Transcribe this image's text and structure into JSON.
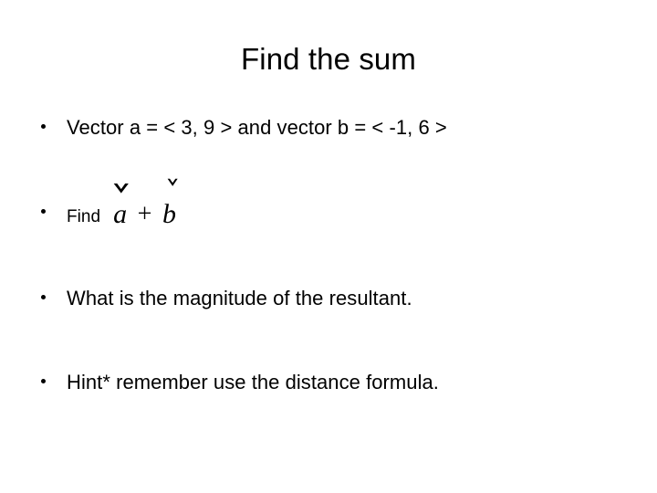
{
  "slide": {
    "background_color": "#ffffff",
    "text_color": "#000000",
    "title": "Find the sum",
    "bullets": [
      {
        "id": "vectors-given",
        "text": "Vector  a = < 3, 9 >  and vector  b = < -1, 6 >"
      },
      {
        "id": "find-sum",
        "text": "Find",
        "math": {
          "left_operand": "a",
          "operator": "+",
          "right_operand": "b",
          "left_accent": "caron",
          "right_accent": "caron",
          "plain": "a + b"
        }
      },
      {
        "id": "magnitude-question",
        "text": "What is the magnitude of the resultant."
      },
      {
        "id": "distance-formula-hint",
        "text": "Hint* remember use the distance formula."
      }
    ]
  }
}
